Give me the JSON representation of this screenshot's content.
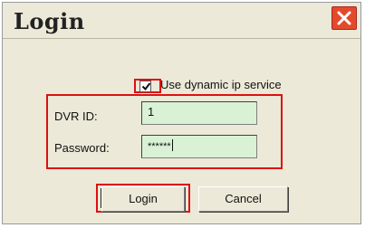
{
  "window": {
    "title": "Login"
  },
  "options": {
    "dynamic_ip_label": "Use dynamic ip service",
    "dynamic_ip_checked": true
  },
  "form": {
    "dvr_id_label": "DVR ID:",
    "dvr_id_value": "1",
    "password_label": "Password:",
    "password_value": "******"
  },
  "buttons": {
    "login_label": "Login",
    "cancel_label": "Cancel"
  },
  "colors": {
    "field_bg": "#d9f2d6",
    "highlight": "#dd1111",
    "close_bg": "#e34a2c",
    "dialog_bg": "#ece9d8"
  }
}
